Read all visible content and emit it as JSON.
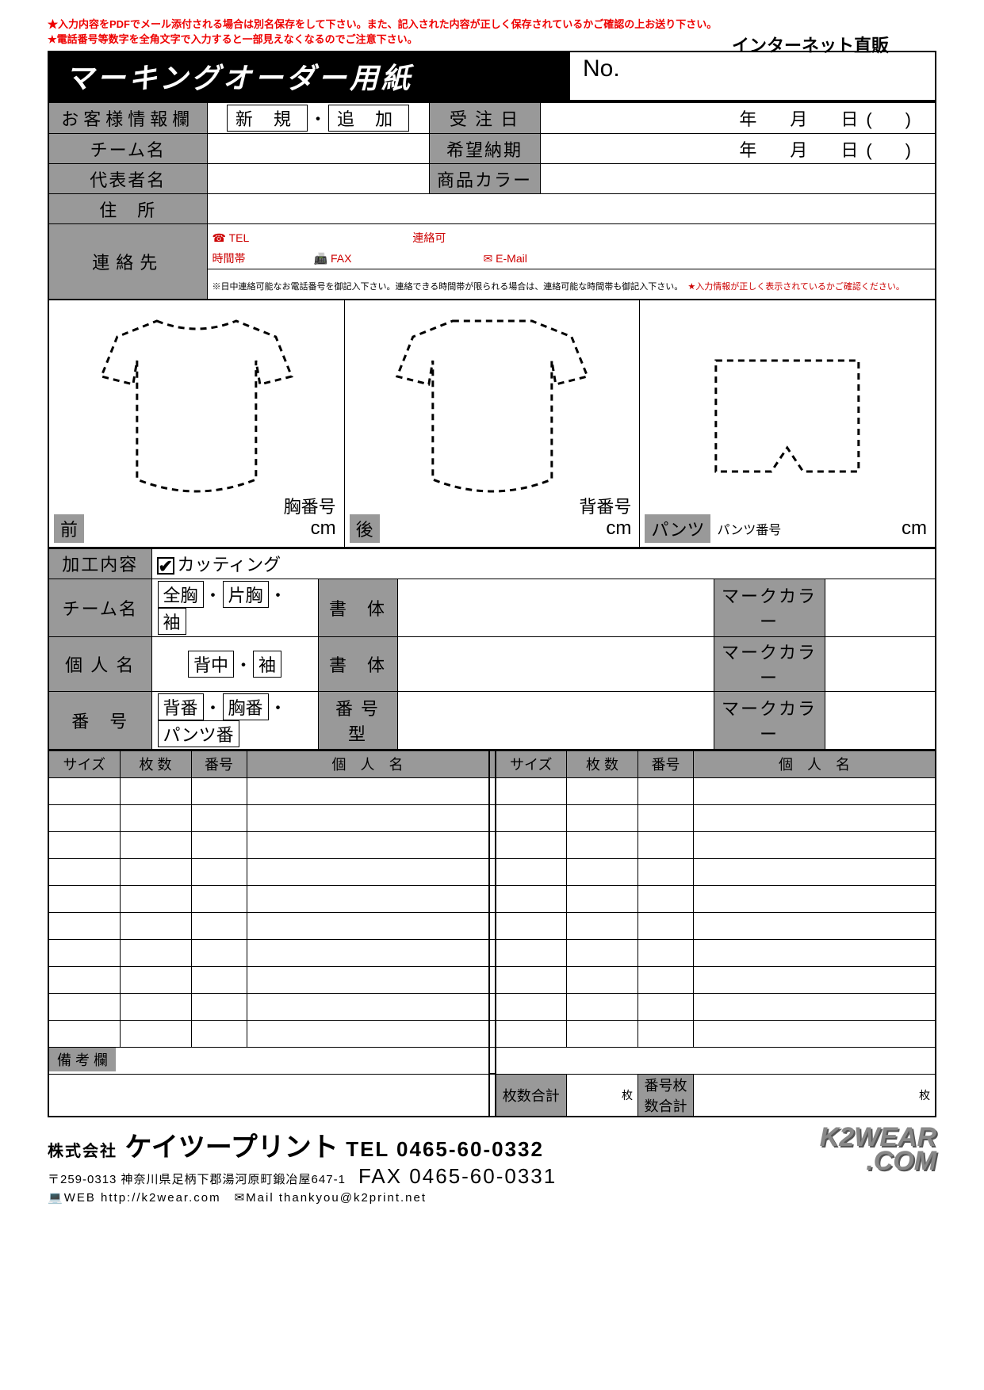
{
  "warnings": {
    "line1a": "★入力内容をPDFでメール添付される場合は",
    "line1b": "別名保存",
    "line1c": "をして下さい。また、",
    "line1d": "記入された内容が正しく保存されているかご確認",
    "line1e": "の上お送り下さい。",
    "line2": "★電話番号等数字を全角文字で入力すると一部見えなくなるのでご注意下さい。"
  },
  "top": {
    "channel": "インターネット直販",
    "title": "マーキングオーダー用紙",
    "no_label": "No."
  },
  "info": {
    "header": "お客様情報欄",
    "new": "新 規",
    "add": "追 加",
    "order_date": "受 注 日",
    "date_fmt": "年　月　日(　)",
    "team": "チーム名",
    "due": "希望納期",
    "rep": "代表者名",
    "color": "商品カラー",
    "addr": "住　所",
    "contact": "連絡先",
    "tel": "TEL",
    "time": "連絡可\n時間帯",
    "fax": "FAX",
    "email": "E-Mail",
    "note1": "※日中連絡可能なお電話番号を御記入下さい。連絡できる時間帯が限られる場合は、連絡可能な時間帯も御記入下さい。",
    "note2": "★入力情報が正しく表示されているかご確認ください。"
  },
  "shirts": {
    "chest_num": "胸番号",
    "back_num": "背番号",
    "front": "前",
    "back": "後",
    "pants": "パンツ",
    "pants_num": "パンツ番号",
    "cm": "cm"
  },
  "proc": {
    "title": "加工内容",
    "cutting": "カッティング",
    "team": "チーム名",
    "opts_team": [
      "全胸",
      "片胸",
      "袖"
    ],
    "style": "書　体",
    "markcolor": "マークカラー",
    "person": "個 人 名",
    "opts_person": [
      "背中",
      "袖"
    ],
    "number": "番　号",
    "opts_number": [
      "背番",
      "胸番",
      "パンツ番"
    ],
    "numtype": "番 号 型"
  },
  "grid": {
    "size": "サイズ",
    "qty": "枚 数",
    "num": "番号",
    "name": "個　人　名",
    "memo": "備 考 欄",
    "total_qty": "枚数合計",
    "total_num": "番号枚数合計",
    "unit": "枚"
  },
  "footer": {
    "kk": "株式会社",
    "company": "ケイツープリント",
    "tel": "TEL 0465-60-0332",
    "fax": "FAX 0465-60-0331",
    "addr": "〒259-0313 神奈川県足柄下郡湯河原町鍛冶屋647-1",
    "web_label": "WEB",
    "web": "http://k2wear.com",
    "mail_label": "Mail",
    "mail": "thankyou@k2print.net",
    "brand1": "K2WEAR",
    "brand2": ".COM"
  }
}
